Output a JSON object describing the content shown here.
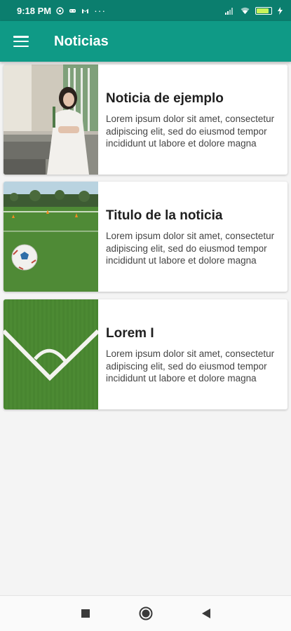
{
  "status_bar": {
    "time": "9:18 PM",
    "dots": "···",
    "battery_level": "",
    "icons": [
      "notification-icon",
      "game-controller-icon",
      "gmail-icon",
      "signal-icon",
      "wifi-icon",
      "battery-icon",
      "charging-icon"
    ]
  },
  "app_bar": {
    "title": "Noticias",
    "menu_icon": "hamburger-menu-icon",
    "color": "#0f9a86"
  },
  "news": [
    {
      "title": "Noticia de ejemplo",
      "description": "Lorem ipsum dolor sit amet, consectetur adipiscing elit, sed do eiusmod tempor incididunt ut labore et dolore magna aliqua.",
      "image": "woman-sitting-photo"
    },
    {
      "title": "Titulo de la noticia",
      "description": "Lorem ipsum dolor sit amet, consectetur adipiscing elit, sed do eiusmod tempor incididunt ut labore et dolore magna aliqua.",
      "image": "soccer-ball-field-photo"
    },
    {
      "title": "Lorem I",
      "description": "Lorem ipsum dolor sit amet, consectetur adipiscing elit, sed do eiusmod tempor incididunt ut labore et dolore magna aliqua.",
      "image": "corner-field-lines-photo"
    }
  ],
  "nav_bar": {
    "buttons": [
      "recents-square-icon",
      "home-circle-icon",
      "back-triangle-icon"
    ]
  }
}
